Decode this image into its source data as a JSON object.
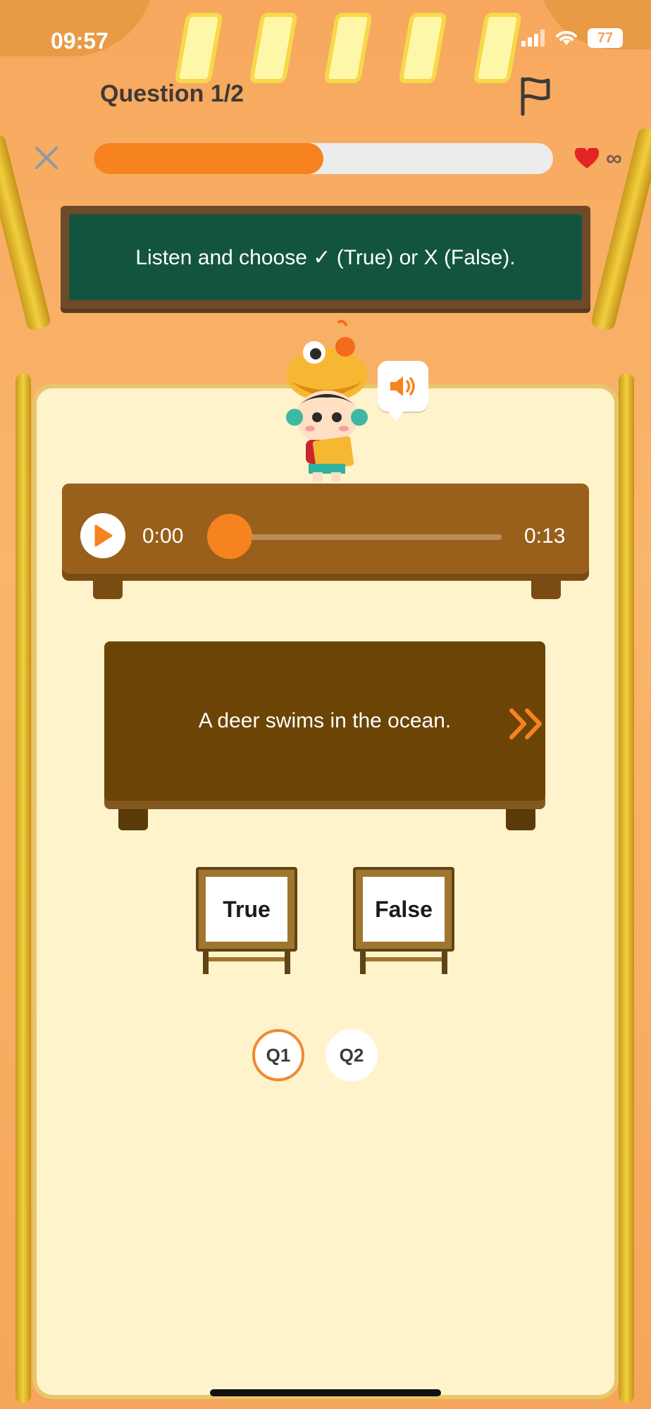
{
  "status_bar": {
    "time": "09:57",
    "battery": "77"
  },
  "header": {
    "title": "Question 1/2"
  },
  "progress": {
    "fraction": 0.5
  },
  "lives": {
    "label": "∞"
  },
  "instruction": {
    "text": "Listen and choose ✓ (True) or X (False)."
  },
  "audio": {
    "current_time": "0:00",
    "end_time": "0:13",
    "progress": 0
  },
  "sentence": {
    "text": "A deer swims in the ocean."
  },
  "choices": [
    {
      "label": "True"
    },
    {
      "label": "False"
    }
  ],
  "pagination": [
    {
      "label": "Q1",
      "active": true
    },
    {
      "label": "Q2",
      "active": false
    }
  ],
  "colors": {
    "accent": "#f6831f",
    "board": "#135440",
    "panel": "#fff3cc",
    "wood": "#98601b"
  }
}
